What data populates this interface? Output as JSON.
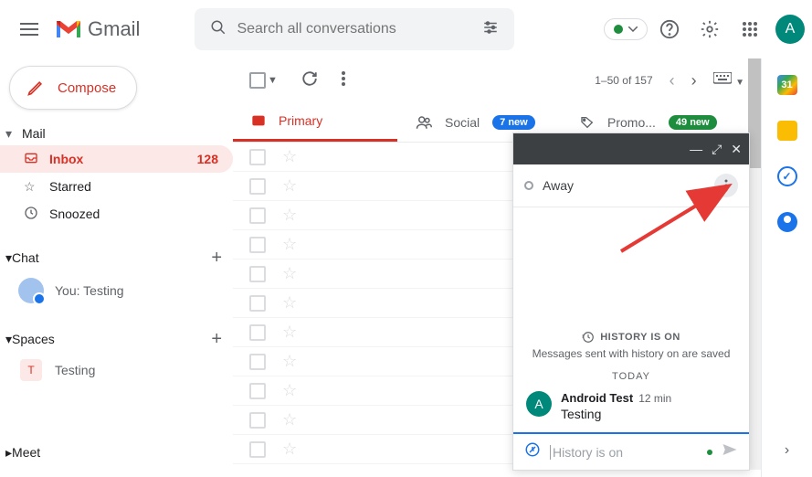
{
  "header": {
    "brand": "Gmail",
    "search_placeholder": "Search all conversations",
    "avatar_letter": "A"
  },
  "compose_label": "Compose",
  "sidebar": {
    "mail_label": "Mail",
    "items": [
      {
        "label": "Inbox",
        "count": "128"
      },
      {
        "label": "Starred"
      },
      {
        "label": "Snoozed"
      }
    ],
    "chat_label": "Chat",
    "chat_item": "You: Testing",
    "spaces_label": "Spaces",
    "space_item": "Testing",
    "space_badge": "T",
    "meet_label": "Meet"
  },
  "toolbar": {
    "range": "1–50 of 157"
  },
  "tabs": {
    "primary": "Primary",
    "social": "Social",
    "social_badge": "7 new",
    "promotions": "Promo...",
    "promotions_badge": "49 new"
  },
  "rail": {
    "calendar_day": "31"
  },
  "chat": {
    "status": "Away",
    "history_icon_label": "HISTORY IS ON",
    "history_sub": "Messages sent with history on are saved",
    "today": "TODAY",
    "sender": "Android Test",
    "sender_letter": "A",
    "time": "12 min",
    "message": "Testing",
    "input_placeholder": "History is on"
  }
}
